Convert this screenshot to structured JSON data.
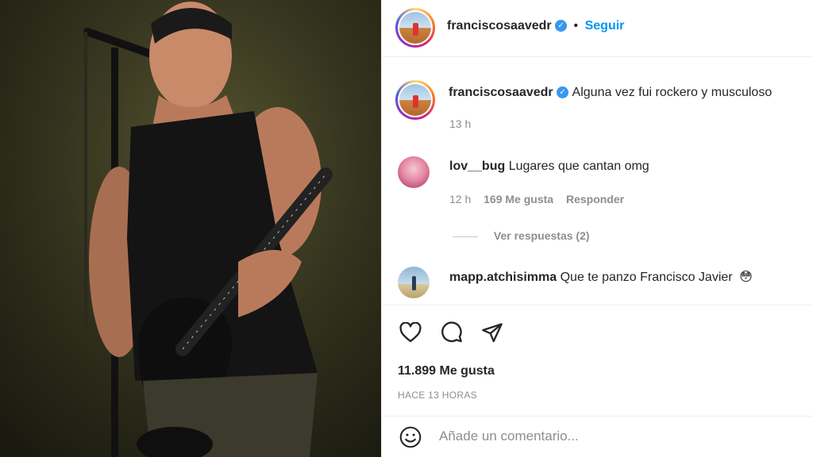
{
  "post": {
    "author": "franciscosaavedr",
    "follow_label": "Seguir",
    "separator": "•",
    "caption": {
      "username": "franciscosaavedr",
      "text": "Alguna vez fui rockero y musculoso",
      "time": "13 h"
    },
    "comments": [
      {
        "username": "lov__bug",
        "text": "Lugares que cantan omg",
        "time": "12 h",
        "likes": "169 Me gusta",
        "reply_label": "Responder",
        "view_replies": "Ver respuestas (2)"
      },
      {
        "username": "mapp.atchisimma",
        "text": "Que te panzo Francisco Javier",
        "emoji": "😳"
      }
    ],
    "likes_count": "11.899 Me gusta",
    "posted_ago": "HACE 13 HORAS",
    "add_comment_placeholder": "Añade un comentario..."
  },
  "icons": [
    "verified-badge-icon",
    "heart-icon",
    "comment-icon",
    "share-icon",
    "emoji-icon"
  ],
  "colors": {
    "link": "#0095f6",
    "verified": "#3897f0",
    "muted": "#8e8e8e"
  }
}
